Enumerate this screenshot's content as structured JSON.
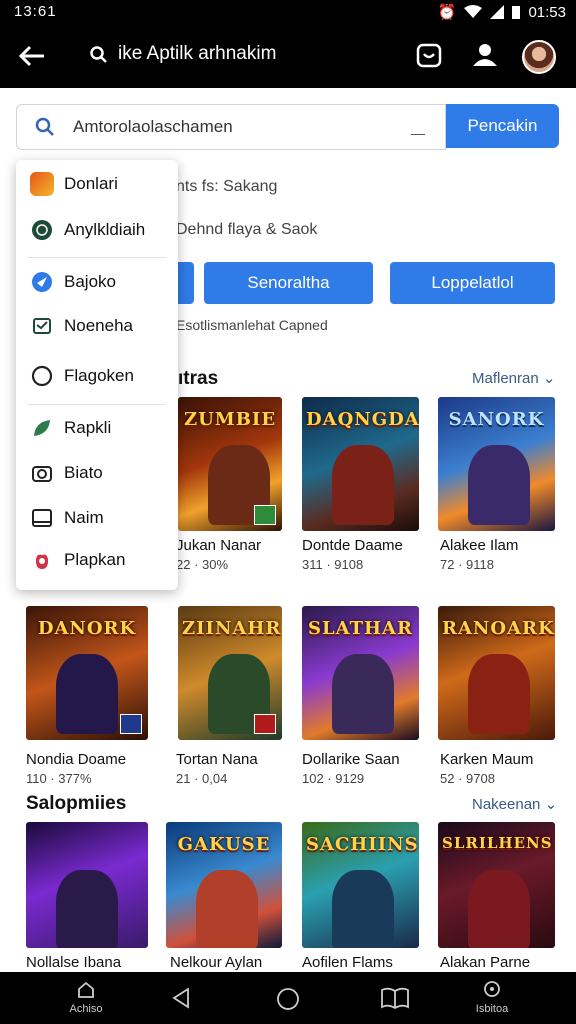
{
  "status": {
    "time": "13:61",
    "clock": "01:53"
  },
  "appbar": {
    "title": "ike Aptilk arhnakim"
  },
  "search": {
    "value": "Amtorolaolaschamen",
    "button": "Pencakin"
  },
  "background": {
    "line1": "nts fs: Sakang",
    "line2": "Dehnd flaya & Saok",
    "chips": [
      "Senoraltha",
      "Loppelatlol"
    ],
    "caption": "Esotlismanlehat Capned"
  },
  "menu": {
    "items": [
      {
        "label": "Donlari",
        "icon": "game-logo-icon"
      },
      {
        "label": "Anylkldiaih",
        "icon": "globe-icon"
      },
      {
        "label": "Bajoko",
        "icon": "compass-icon"
      },
      {
        "label": "Noeneha",
        "icon": "mail-icon"
      },
      {
        "label": "Flagoken",
        "icon": "circle-icon"
      },
      {
        "label": "Rapkli",
        "icon": "leaf-icon"
      },
      {
        "label": "Biato",
        "icon": "camera-icon"
      },
      {
        "label": "Naim",
        "icon": "window-icon"
      },
      {
        "label": "Plapkan",
        "icon": "hand-icon"
      }
    ]
  },
  "sections": [
    {
      "title": "ıtras",
      "more": "Maflenran"
    },
    {
      "title": "Salopmiies",
      "more": "Nakeenan"
    }
  ],
  "row1": [
    {
      "name": "Jukan Nanar",
      "meta": "22 · 30%",
      "logo": "ZUMBIE"
    },
    {
      "name": "Dontde Daame",
      "meta": "311 · 9108",
      "logo": "DAQNGDA"
    },
    {
      "name": "Alakee Ilam",
      "meta": "72 · 9118",
      "logo": "SANORK"
    }
  ],
  "row2": [
    {
      "name": "Nondia Doame",
      "meta": "110 · 377%",
      "logo": "DANORK"
    },
    {
      "name": "Tortan Nana",
      "meta": "21 · 0,04",
      "logo": "ZIINAHR"
    },
    {
      "name": "Dollarike Saan",
      "meta": "102 · 9129",
      "logo": "SLATHAR"
    },
    {
      "name": "Karken Maum",
      "meta": "52 · 9708",
      "logo": "RANOARK"
    }
  ],
  "row3": [
    {
      "name": "Nollalse Ibana",
      "logo": ""
    },
    {
      "name": "Nelkour Aylan",
      "logo": "GAKUSE"
    },
    {
      "name": "Aofilen Flams",
      "logo": "SACHIINS"
    },
    {
      "name": "Alakan Parne",
      "logo": "SLRILHENS"
    }
  ],
  "bottomnav": {
    "home": "Achiso",
    "right": "Isbitoa"
  }
}
